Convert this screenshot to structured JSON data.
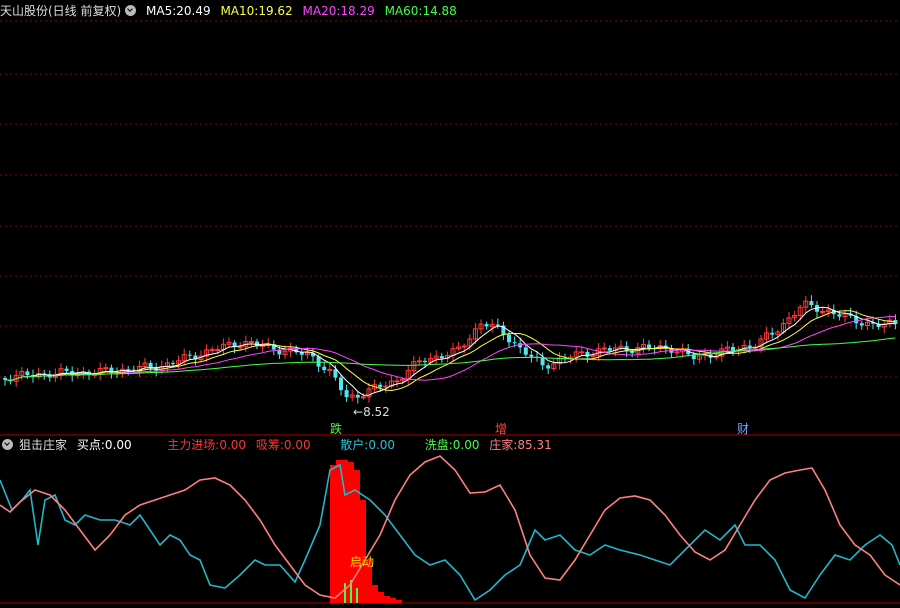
{
  "main_header": {
    "stock_title": "天山股份(日线 前复权)",
    "ma": [
      {
        "label": "MA5: ",
        "value": "20.49",
        "color": "#ffffff"
      },
      {
        "label": "MA10: ",
        "value": "19.62",
        "color": "#ffff44"
      },
      {
        "label": "MA20: ",
        "value": "18.29",
        "color": "#ff44ff"
      },
      {
        "label": "MA60: ",
        "value": "14.88",
        "color": "#44ff44"
      }
    ]
  },
  "low_annotation": "8.52",
  "markers": [
    {
      "text": "跌",
      "color": "#44ff44"
    },
    {
      "text": "增",
      "color": "#ff4444"
    },
    {
      "text": "财",
      "color": "#6fa8ff"
    }
  ],
  "indicator_header": {
    "name": "狙击庄家",
    "items": [
      {
        "label": "买点: ",
        "value": "0.00",
        "color": "#ffffff"
      },
      {
        "label": "主力进场: ",
        "value": "0.00",
        "color": "#ff3333"
      },
      {
        "label": "吸筹: ",
        "value": "0.00",
        "color": "#ff3333"
      },
      {
        "label": "散户: ",
        "value": "0.00",
        "color": "#22c4d6"
      },
      {
        "label": "洗盘: ",
        "value": "0.00",
        "color": "#44ff44"
      },
      {
        "label": "庄家: ",
        "value": "85.31",
        "color": "#ff8080"
      }
    ]
  },
  "signal_label": "启动",
  "colors": {
    "up": "#ff3b3b",
    "down": "#4ee8f0",
    "grid": "#8b0000",
    "retail": "#22b7c8",
    "dealer": "#ff7f7f",
    "bar": "#ff0000"
  }
}
